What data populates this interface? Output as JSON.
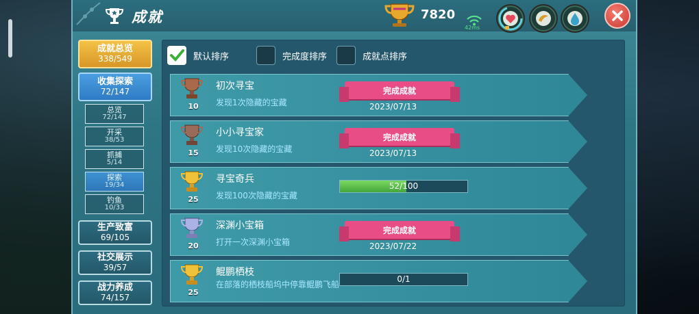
{
  "header": {
    "title": "成就",
    "score": "7820",
    "ping": "42ms"
  },
  "colors": {
    "panel": "#2f7685",
    "accent_gold": "#e8a82e",
    "ribbon_pink": "#e84d86",
    "progress_green": "#5bc24a"
  },
  "nav": {
    "main": [
      {
        "label": "成就总览",
        "count": "338/549"
      },
      {
        "label": "收集探索",
        "count": "72/147"
      },
      {
        "label": "生产致富",
        "count": "69/105"
      },
      {
        "label": "社交展示",
        "count": "39/57"
      },
      {
        "label": "战力养成",
        "count": "74/157"
      }
    ],
    "sub": [
      {
        "label": "总览",
        "count": "72/147"
      },
      {
        "label": "开采",
        "count": "38/53"
      },
      {
        "label": "抓捕",
        "count": "5/14"
      },
      {
        "label": "探索",
        "count": "19/34"
      },
      {
        "label": "钓鱼",
        "count": "10/33"
      }
    ]
  },
  "sort": [
    {
      "label": "默认排序",
      "checked": true
    },
    {
      "label": "完成度排序",
      "checked": false
    },
    {
      "label": "成就点排序",
      "checked": false
    }
  ],
  "achievements": [
    {
      "title": "初次寻宝",
      "desc": "发现1次隐藏的宝藏",
      "points": "10",
      "trophy": "bronze-trophy-icon",
      "status": "完成成就",
      "date": "2023/07/13"
    },
    {
      "title": "小小寻宝家",
      "desc": "发现10次隐藏的宝藏",
      "points": "15",
      "trophy": "bronze-trophy-icon",
      "status": "完成成就",
      "date": "2023/07/13"
    },
    {
      "title": "寻宝奇兵",
      "desc": "发现100次隐藏的宝藏",
      "points": "25",
      "trophy": "gold-trophy-icon",
      "progress_text": "52/100",
      "progress_value": 0.52
    },
    {
      "title": "深渊小宝箱",
      "desc": "打开一次深渊小宝箱",
      "points": "20",
      "trophy": "silver-trophy-icon",
      "status": "完成成就",
      "date": "2023/07/22"
    },
    {
      "title": "鲲鹏栖枝",
      "desc": "在部落的栖枝船坞中停靠鲲鹏飞船",
      "points": "25",
      "trophy": "gold-trophy-icon",
      "progress_text": "0/1",
      "progress_value": 0
    }
  ]
}
